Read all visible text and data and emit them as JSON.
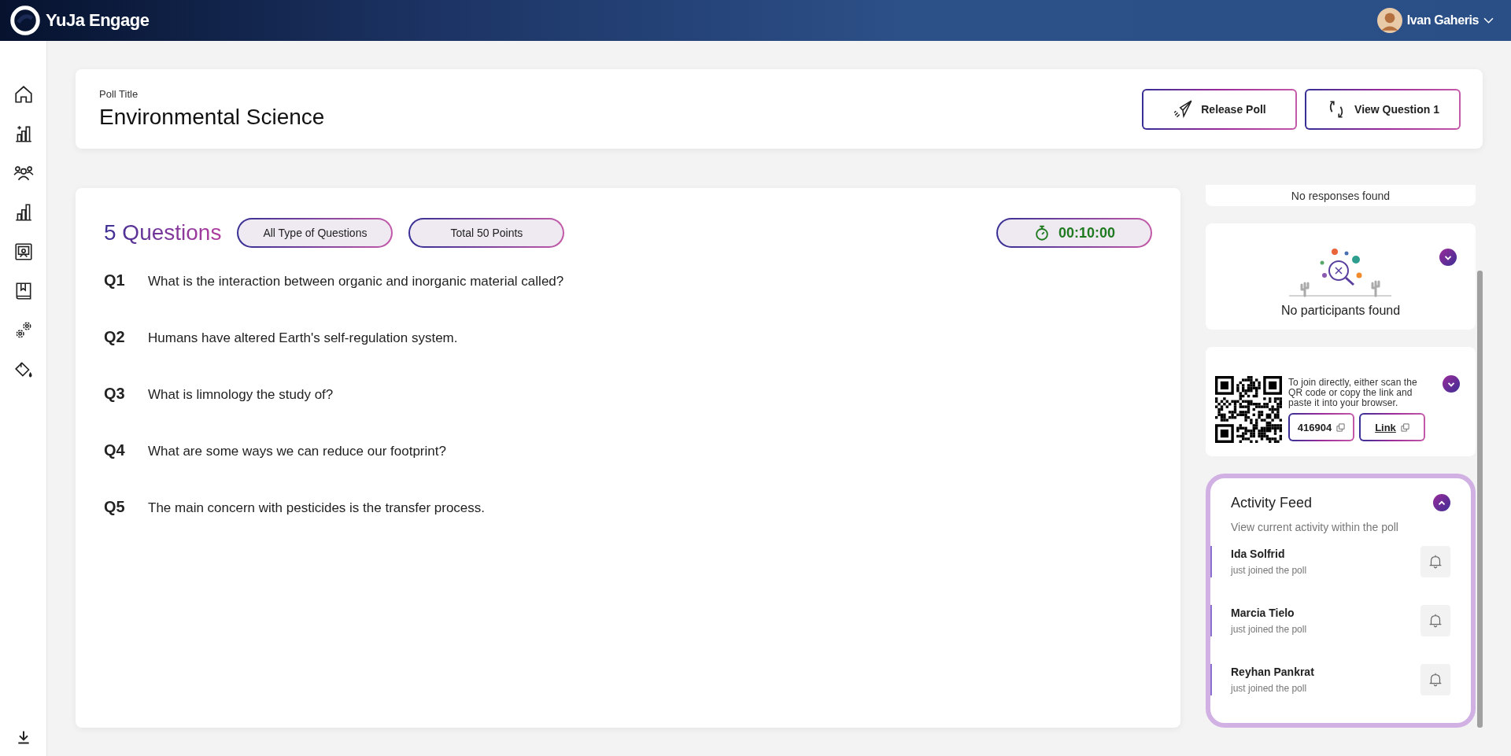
{
  "app": {
    "name": "YuJa Engage"
  },
  "user": {
    "name": "Ivan Gaheris"
  },
  "poll": {
    "label": "Poll Title",
    "title": "Environmental Science"
  },
  "actions": [
    {
      "label": "Release Poll",
      "kind": "release"
    },
    {
      "label": "View Question 1",
      "kind": "view"
    }
  ],
  "questions_panel": {
    "heading": "5 Questions",
    "filters": [
      "All Type of Questions",
      "Total 50 Points"
    ],
    "timer": "00:10:00",
    "questions": [
      {
        "number": "Q1",
        "text": "What is the interaction between organic and inorganic material called?"
      },
      {
        "number": "Q2",
        "text": "Humans have altered Earth's self-regulation system."
      },
      {
        "number": "Q3",
        "text": "What is limnology the study of?"
      },
      {
        "number": "Q4",
        "text": "What are some ways we can reduce our footprint?"
      },
      {
        "number": "Q5",
        "text": "The main concern with pesticides is the transfer process."
      }
    ]
  },
  "responses": {
    "message": "No responses found"
  },
  "participants": {
    "message": "No participants found",
    "expanded": false
  },
  "join": {
    "instructions": "To join directly, either scan the QR code or copy the link and paste it into your browser.",
    "code": "416904",
    "link": "Link",
    "expanded": false
  },
  "activity_feed": {
    "title": "Activity Feed",
    "subtitle": "View current activity within the poll",
    "expanded": true,
    "items": [
      {
        "name": "Ida Solfrid",
        "action": "just joined the poll"
      },
      {
        "name": "Marcia Tielo",
        "action": "just joined the poll"
      },
      {
        "name": "Reyhan Pankrat",
        "action": "just joined the poll"
      }
    ]
  }
}
